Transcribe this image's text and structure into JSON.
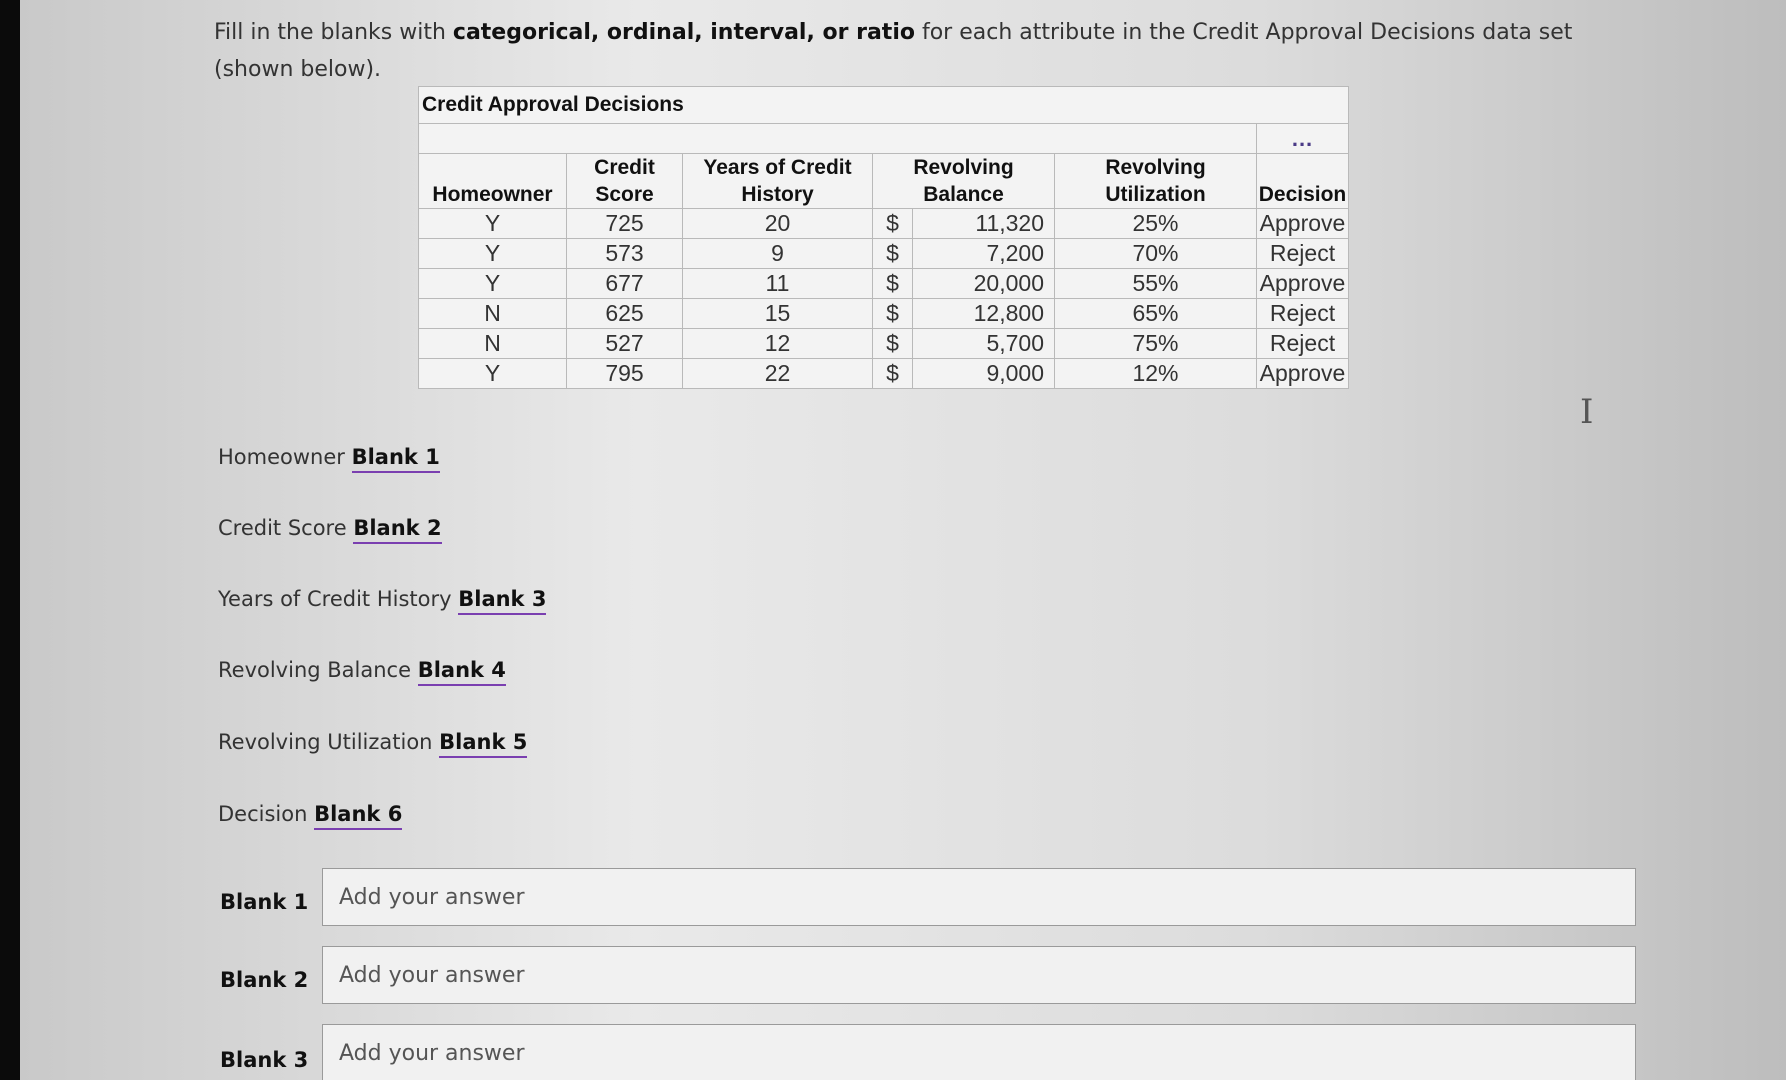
{
  "prompt": {
    "p1": "Fill in the blanks with ",
    "bold": "categorical, ordinal, interval, or ratio",
    "p2": " for each attribute in the Credit Approval Decisions data set (shown below)."
  },
  "table": {
    "title": "Credit Approval Decisions",
    "ellipsis": "...",
    "headers": {
      "homeowner": "Homeowner",
      "credit_score": "Credit Score",
      "years_l1": "Years of Credit",
      "years_l2": "History",
      "balance_l1": "Revolving",
      "balance_l2": "Balance",
      "util_l1": "Revolving",
      "util_l2": "Utilization",
      "decision": "Decision"
    },
    "rows": [
      {
        "homeowner": "Y",
        "credit_score": "725",
        "years": "20",
        "currency": "$",
        "balance": "11,320",
        "utilization": "25%",
        "decision": "Approve"
      },
      {
        "homeowner": "Y",
        "credit_score": "573",
        "years": "9",
        "currency": "$",
        "balance": "7,200",
        "utilization": "70%",
        "decision": "Reject"
      },
      {
        "homeowner": "Y",
        "credit_score": "677",
        "years": "11",
        "currency": "$",
        "balance": "20,000",
        "utilization": "55%",
        "decision": "Approve"
      },
      {
        "homeowner": "N",
        "credit_score": "625",
        "years": "15",
        "currency": "$",
        "balance": "12,800",
        "utilization": "65%",
        "decision": "Reject"
      },
      {
        "homeowner": "N",
        "credit_score": "527",
        "years": "12",
        "currency": "$",
        "balance": "5,700",
        "utilization": "75%",
        "decision": "Reject"
      },
      {
        "homeowner": "Y",
        "credit_score": "795",
        "years": "22",
        "currency": "$",
        "balance": "9,000",
        "utilization": "12%",
        "decision": "Approve"
      }
    ]
  },
  "attributes": [
    {
      "label": "Homeowner",
      "blank": "Blank 1"
    },
    {
      "label": "Credit Score",
      "blank": "Blank 2"
    },
    {
      "label": "Years of Credit History",
      "blank": "Blank 3"
    },
    {
      "label": "Revolving Balance",
      "blank": "Blank 4"
    },
    {
      "label": "Revolving Utilization",
      "blank": "Blank 5"
    },
    {
      "label": "Decision",
      "blank": "Blank 6"
    }
  ],
  "answers": [
    {
      "label": "Blank 1",
      "placeholder": "Add your answer",
      "value": ""
    },
    {
      "label": "Blank 2",
      "placeholder": "Add your answer",
      "value": ""
    },
    {
      "label": "Blank 3",
      "placeholder": "Add your answer",
      "value": ""
    }
  ],
  "icons": {
    "text_cursor": "text-cursor-icon"
  }
}
